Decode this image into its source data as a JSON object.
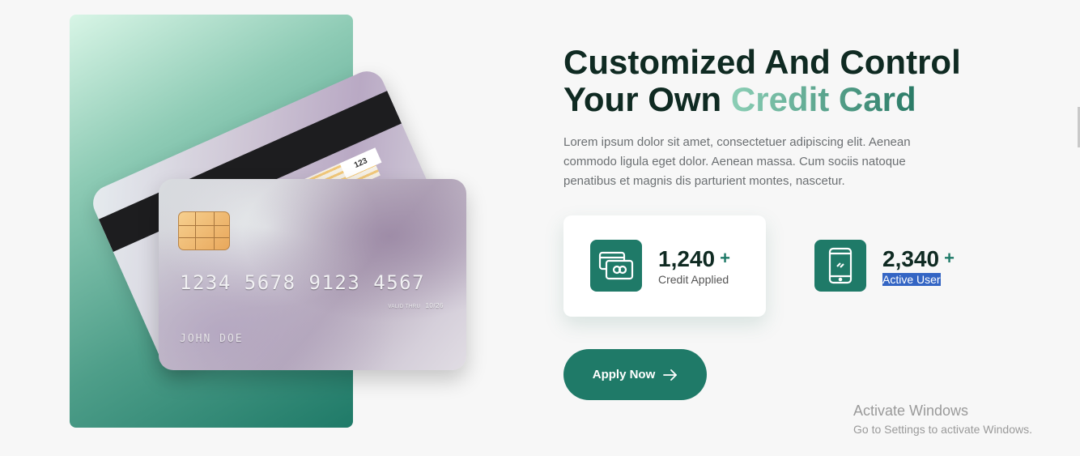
{
  "hero": {
    "card_back": {
      "cvv": "123",
      "small_text": "Authorized signature"
    },
    "card_front": {
      "number": "1234 5678 9123 4567",
      "valid_label": "VALID THRU",
      "valid_date": "10/26",
      "holder": "JOHN DOE"
    }
  },
  "content": {
    "heading_line1": "Customized And Control",
    "heading_line2_plain": "Your Own ",
    "heading_line2_accent": "Credit Card",
    "description": "Lorem ipsum dolor sit amet, consectetuer adipiscing elit. Aenean commodo ligula eget dolor. Aenean massa. Cum sociis natoque penatibus et magnis dis parturient montes, nascetur.",
    "stats": [
      {
        "value": "1,240",
        "plus": "+",
        "label": "Credit Applied",
        "icon": "cash-icon"
      },
      {
        "value": "2,340",
        "plus": "+",
        "label": "Active User",
        "icon": "smartphone-icon"
      }
    ],
    "apply_button": "Apply Now"
  },
  "os_overlay": {
    "title": "Activate Windows",
    "subtitle": "Go to Settings to activate Windows."
  },
  "colors": {
    "accent": "#1f7a68",
    "heading": "#0f2a22",
    "background": "#f7f7f7"
  }
}
